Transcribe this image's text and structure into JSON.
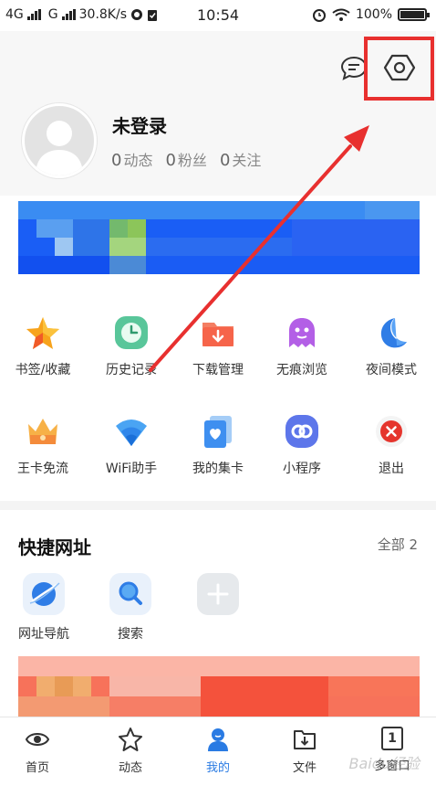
{
  "status_bar": {
    "network_1": "4G",
    "network_2": "G",
    "speed": "30.8K/s",
    "time": "10:54",
    "battery": "100%"
  },
  "profile": {
    "username": "未登录",
    "stats": [
      {
        "count": "0",
        "label": "动态"
      },
      {
        "count": "0",
        "label": "粉丝"
      },
      {
        "count": "0",
        "label": "关注"
      }
    ]
  },
  "tools": [
    {
      "label": "书签/收藏",
      "icon": "star-icon"
    },
    {
      "label": "历史记录",
      "icon": "clock-icon"
    },
    {
      "label": "下载管理",
      "icon": "download-folder-icon"
    },
    {
      "label": "无痕浏览",
      "icon": "ghost-icon"
    },
    {
      "label": "夜间模式",
      "icon": "moon-icon"
    },
    {
      "label": "王卡免流",
      "icon": "crown-icon"
    },
    {
      "label": "WiFi助手",
      "icon": "wifi-icon"
    },
    {
      "label": "我的集卡",
      "icon": "card-heart-icon"
    },
    {
      "label": "小程序",
      "icon": "mini-program-icon"
    },
    {
      "label": "退出",
      "icon": "exit-icon"
    }
  ],
  "quick_links": {
    "title": "快捷网址",
    "more": "全部 2",
    "items": [
      {
        "label": "网址导航",
        "icon": "planet-icon"
      },
      {
        "label": "搜索",
        "icon": "search-icon"
      },
      {
        "label": "",
        "icon": "add-icon"
      }
    ]
  },
  "tabbar": [
    {
      "label": "首页",
      "icon": "eye-icon",
      "active": false
    },
    {
      "label": "动态",
      "icon": "star-outline-icon",
      "active": false
    },
    {
      "label": "我的",
      "icon": "person-icon",
      "active": true
    },
    {
      "label": "文件",
      "icon": "file-download-icon",
      "active": false
    },
    {
      "label": "多窗口",
      "icon": "window-count-icon",
      "active": false,
      "badge": "1"
    }
  ],
  "watermark": "Baidu经验",
  "colors": {
    "accent": "#2a7be3",
    "annotation": "#e8302f"
  }
}
